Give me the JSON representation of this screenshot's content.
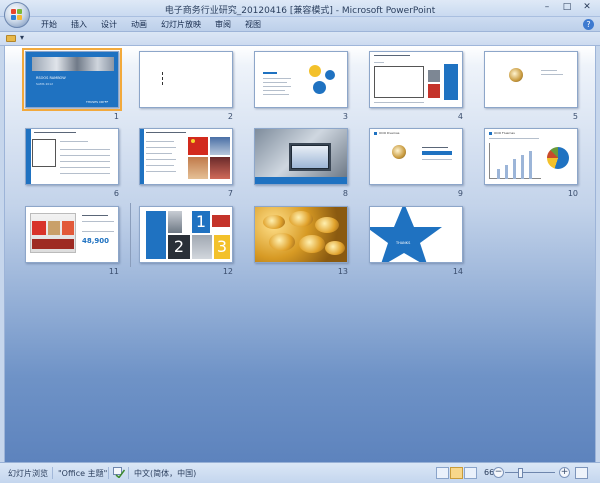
{
  "window": {
    "title": "电子商务行业研究_20120416 [兼容模式] - Microsoft PowerPoint",
    "minimize": "–",
    "maximize": "□",
    "close": "✕"
  },
  "ribbon": {
    "tabs": [
      "开始",
      "插入",
      "设计",
      "动画",
      "幻灯片放映",
      "审阅",
      "视图"
    ],
    "help": "?"
  },
  "qat": {
    "folder_icon": "open-folder-icon",
    "customize": "▾"
  },
  "slides": [
    {
      "number": "1",
      "title_text": "RSOOS RAMBOW",
      "sub_text": "SAMS 2012",
      "footer": "THUSES CRYFF"
    },
    {
      "number": "2"
    },
    {
      "number": "3"
    },
    {
      "number": "4"
    },
    {
      "number": "5"
    },
    {
      "number": "6"
    },
    {
      "number": "7"
    },
    {
      "number": "8"
    },
    {
      "number": "9",
      "heading": "OOO Dvernas"
    },
    {
      "number": "10",
      "heading": "OOO Fluernas"
    },
    {
      "number": "11",
      "big_number": "48,900"
    },
    {
      "number": "12",
      "digits": [
        "1",
        "2",
        "3"
      ]
    },
    {
      "number": "13"
    },
    {
      "number": "14",
      "label": "THANKS"
    }
  ],
  "status": {
    "view_name": "幻灯片浏览",
    "theme": "\"Office 主题\"",
    "language": "中文(简体，中国)",
    "zoom": "66%",
    "zoom_value": 0.66,
    "zoom_minus": "−",
    "zoom_plus": "+"
  },
  "colors": {
    "accent": "#1f72c1",
    "selection": "#f2a93c"
  }
}
